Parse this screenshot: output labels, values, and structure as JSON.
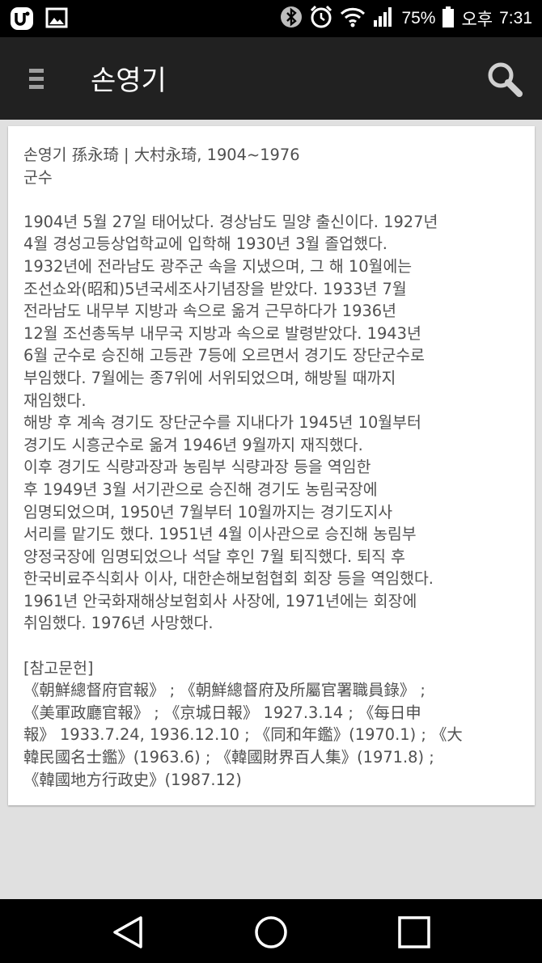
{
  "status_bar": {
    "battery": "75%",
    "ampm": "오후",
    "time": "7:31"
  },
  "app_bar": {
    "title": "손영기"
  },
  "article": {
    "lines": [
      "손영기 孫永琦 | 大村永琦, 1904~1976",
      "군수",
      "",
      "1904년 5월 27일 태어났다. 경상남도 밀양 출신이다. 1927년",
      "4월 경성고등상업학교에 입학해 1930년 3월 졸업했다.",
      "1932년에 전라남도 광주군 속을 지냈으며, 그 해 10월에는",
      "조선쇼와(昭和)5년국세조사기념장을 받았다. 1933년 7월",
      "전라남도 내무부 지방과 속으로 옮겨 근무하다가 1936년",
      "12월 조선총독부 내무국 지방과 속으로 발령받았다. 1943년",
      "6월 군수로 승진해 고등관 7등에 오르면서 경기도 장단군수로",
      "부임했다. 7월에는 종7위에 서위되었으며, 해방될 때까지",
      "재임했다.",
      "해방 후 계속 경기도 장단군수를 지내다가 1945년 10월부터",
      "경기도 시흥군수로 옮겨 1946년 9월까지 재직했다.",
      "이후 경기도 식량과장과 농림부 식량과장 등을 역임한",
      "후 1949년 3월 서기관으로 승진해 경기도 농림국장에",
      "임명되었으며, 1950년 7월부터 10월까지는 경기도지사",
      "서리를 맡기도 했다. 1951년 4월 이사관으로 승진해 농림부",
      "양정국장에 임명되었으나 석달 후인 7월 퇴직했다. 퇴직 후",
      "한국비료주식회사 이사, 대한손해보험협회 회장 등을 역임했다.",
      "1961년 안국화재해상보험회사 사장에, 1971년에는 회장에",
      "취임했다. 1976년 사망했다.",
      "",
      "[참고문헌]",
      "《朝鮮總督府官報》 ; 《朝鮮總督府及所屬官署職員錄》 ;",
      "《美軍政廳官報》 ; 《京城日報》 1927.3.14 ; 《每日申",
      "報》 1933.7.24, 1936.12.10 ; 《同和年鑑》(1970.1) ; 《大",
      "韓民國名士鑑》(1963.6) ; 《韓國財界百人集》(1971.8) ;",
      "《韓國地方行政史》(1987.12)"
    ]
  },
  "icons": {
    "status_left": [
      "u-plus-icon",
      "image-icon"
    ],
    "status_right": [
      "bluetooth-icon",
      "alarm-icon",
      "wifi-icon",
      "signal-icon",
      "battery-icon"
    ],
    "nav": [
      "back-icon",
      "home-icon",
      "recents-icon"
    ]
  }
}
